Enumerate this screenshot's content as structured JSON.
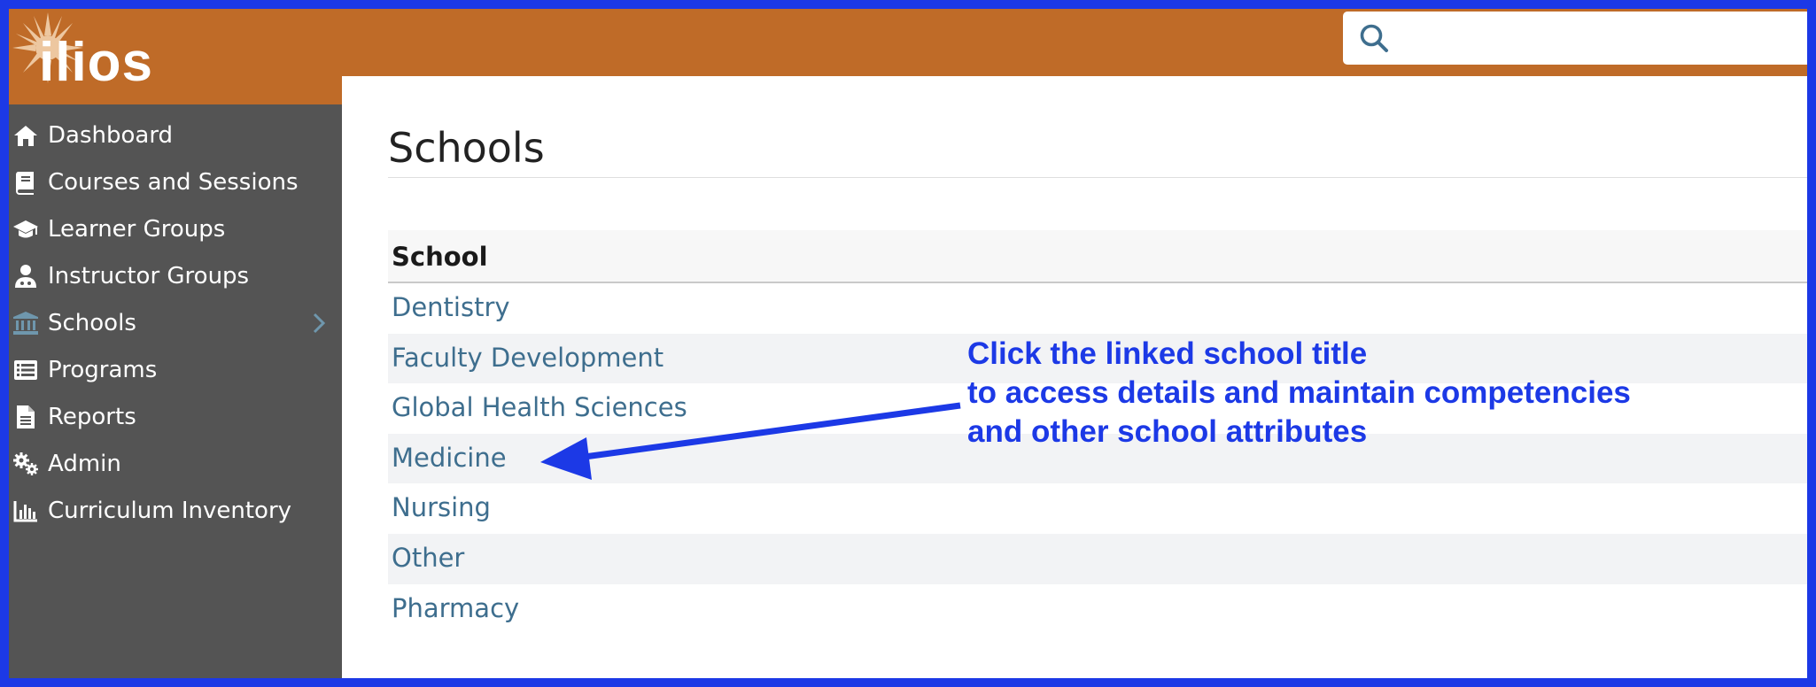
{
  "app": {
    "logo_text": "ilios"
  },
  "search": {
    "placeholder": "",
    "value": ""
  },
  "sidebar": {
    "items": [
      {
        "label": "Dashboard",
        "icon": "home-icon"
      },
      {
        "label": "Courses and Sessions",
        "icon": "book-icon"
      },
      {
        "label": "Learner Groups",
        "icon": "graduation-cap-icon"
      },
      {
        "label": "Instructor Groups",
        "icon": "user-doctor-icon"
      },
      {
        "label": "Schools",
        "icon": "university-icon",
        "active": true
      },
      {
        "label": "Programs",
        "icon": "list-icon"
      },
      {
        "label": "Reports",
        "icon": "file-icon"
      },
      {
        "label": "Admin",
        "icon": "cogs-icon"
      },
      {
        "label": "Curriculum Inventory",
        "icon": "bar-chart-icon"
      }
    ]
  },
  "main": {
    "title": "Schools",
    "table": {
      "header": "School",
      "rows": [
        "Dentistry",
        "Faculty Development",
        "Global Health Sciences",
        "Medicine",
        "Nursing",
        "Other",
        "Pharmacy"
      ]
    }
  },
  "annotation": {
    "lines": [
      "Click the linked school title",
      "to access details and maintain competencies",
      "and other school attributes"
    ]
  },
  "colors": {
    "header_orange": "#bf6b28",
    "sidebar_gray": "#545454",
    "link_blue": "#3e6e8e",
    "active_icon": "#6f97ad",
    "annotation_blue": "#1c39e6"
  }
}
